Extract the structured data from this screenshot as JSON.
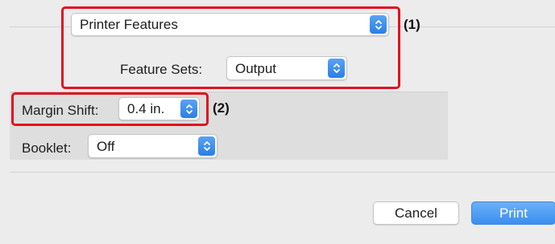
{
  "printer_panel": {
    "value": "Printer Features",
    "callout": "(1)"
  },
  "feature_sets": {
    "label": "Feature Sets:",
    "value": "Output"
  },
  "margin_shift": {
    "label": "Margin Shift:",
    "value": "0.4 in.",
    "callout": "(2)"
  },
  "booklet": {
    "label": "Booklet:",
    "value": "Off"
  },
  "buttons": {
    "cancel": "Cancel",
    "print": "Print"
  },
  "colors": {
    "callout_border": "#e0101f",
    "accent": "#2a7fe6"
  },
  "icons": {
    "stepper": "up-down-chevrons-icon"
  }
}
